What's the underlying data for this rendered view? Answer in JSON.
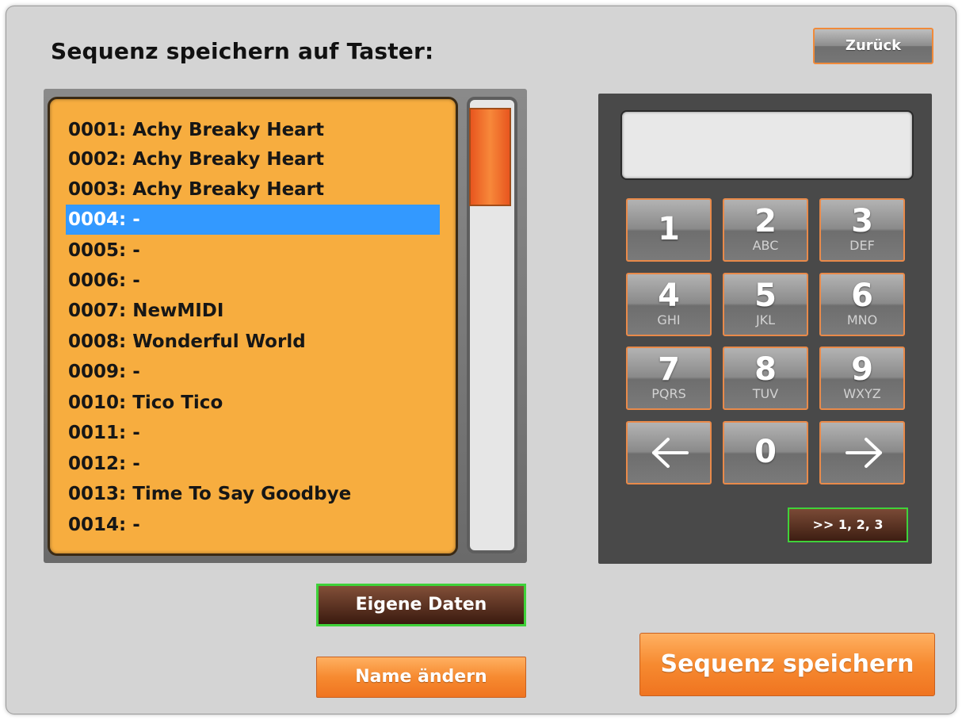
{
  "title": "Sequenz speichern auf Taster:",
  "buttons": {
    "back": "Zurück",
    "mode": ">> 1, 2, 3",
    "own_data": "Eigene Daten",
    "rename": "Name ändern",
    "save": "Sequenz speichern"
  },
  "list": {
    "selected_index": 3,
    "items": [
      "0001: Achy Breaky Heart",
      "0002: Achy Breaky Heart",
      "0003: Achy Breaky Heart",
      "0004: -",
      "0005: -",
      "0006: -",
      "0007: NewMIDI",
      "0008: Wonderful World",
      "0009: -",
      "0010: Tico Tico",
      "0011: -",
      "0012: -",
      "0013: Time To Say Goodbye",
      "0014: -"
    ]
  },
  "display": {
    "value": ""
  },
  "keypad": {
    "keys": [
      {
        "num": "1",
        "letters": ""
      },
      {
        "num": "2",
        "letters": "ABC"
      },
      {
        "num": "3",
        "letters": "DEF"
      },
      {
        "num": "4",
        "letters": "GHI"
      },
      {
        "num": "5",
        "letters": "JKL"
      },
      {
        "num": "6",
        "letters": "MNO"
      },
      {
        "num": "7",
        "letters": "PQRS"
      },
      {
        "num": "8",
        "letters": "TUV"
      },
      {
        "num": "9",
        "letters": "WXYZ"
      },
      {
        "icon": "arrow-left-icon"
      },
      {
        "num": "0",
        "letters": ""
      },
      {
        "icon": "arrow-right-icon"
      }
    ]
  },
  "colors": {
    "list_bg": "#f7ad3f",
    "selection": "#3399ff",
    "accent_orange": "#f68a30",
    "active_green": "#3fd23a"
  }
}
